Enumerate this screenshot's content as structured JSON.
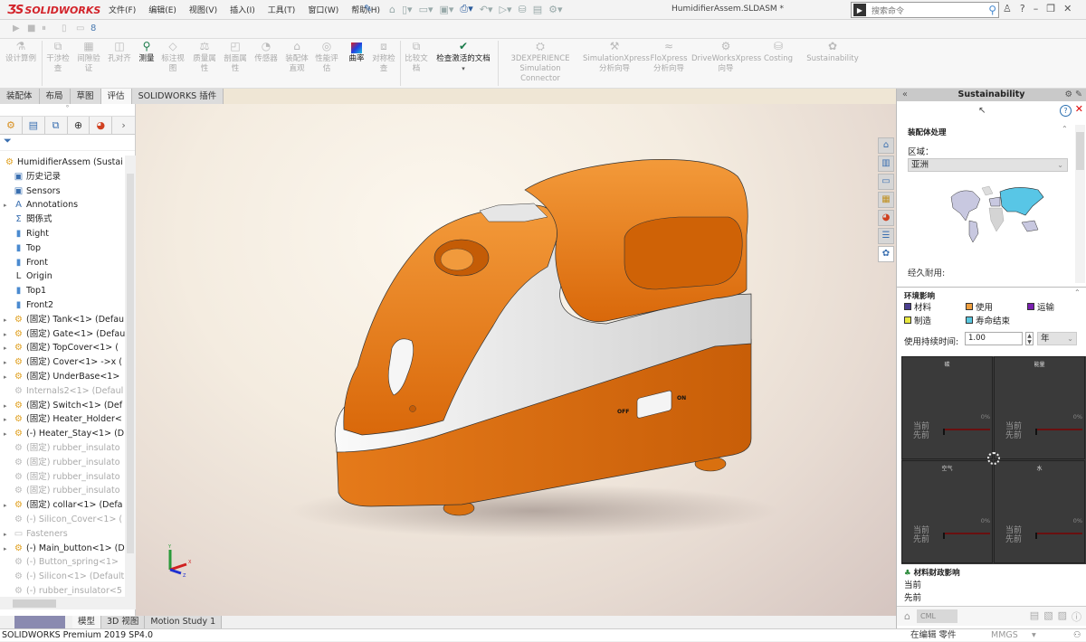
{
  "app": {
    "brand": "SOLIDWORKS",
    "document_title": "HumidifierAssem.SLDASM *",
    "menu": [
      "文件(F)",
      "编辑(E)",
      "视图(V)",
      "插入(I)",
      "工具(T)",
      "窗口(W)",
      "帮助(H)"
    ],
    "search_placeholder": "搜索命令",
    "window_controls": [
      "?",
      "–",
      "❐",
      "✕"
    ]
  },
  "command_manager": {
    "buttons": [
      {
        "label": "设计算例",
        "enabled": false
      },
      {
        "label": "干涉检查",
        "enabled": false
      },
      {
        "label": "间隙验证",
        "enabled": false
      },
      {
        "label": "孔对齐",
        "enabled": false
      },
      {
        "label": "测量",
        "enabled": true
      },
      {
        "label": "标注视图",
        "enabled": false
      },
      {
        "label": "质量属性",
        "enabled": false
      },
      {
        "label": "剖面属性",
        "enabled": false
      },
      {
        "label": "传感器",
        "enabled": false
      },
      {
        "label": "装配体直观",
        "enabled": false
      },
      {
        "label": "性能评估",
        "enabled": false
      },
      {
        "label": "曲率",
        "enabled": true
      },
      {
        "label": "对称检查",
        "enabled": false
      },
      {
        "label": "比较文档",
        "enabled": false
      },
      {
        "label": "检查激活的文档",
        "enabled": true
      },
      {
        "label": "3DEXPERIENCE Simulation Connector",
        "enabled": false
      },
      {
        "label": "SimulationXpress 分析向导",
        "enabled": false
      },
      {
        "label": "FloXpress 分析向导",
        "enabled": false
      },
      {
        "label": "DriveWorksXpress 向导",
        "enabled": false
      },
      {
        "label": "Costing",
        "enabled": false
      },
      {
        "label": "Sustainability",
        "enabled": false
      }
    ]
  },
  "tabs": [
    {
      "label": "装配体",
      "active": false
    },
    {
      "label": "布局",
      "active": false
    },
    {
      "label": "草图",
      "active": false
    },
    {
      "label": "评估",
      "active": true
    },
    {
      "label": "SOLIDWORKS 插件",
      "active": false
    }
  ],
  "feature_tree": {
    "root": "HumidifierAssem  (Sustai",
    "items": [
      {
        "label": "历史记录",
        "icon": "history-folder",
        "expandable": false,
        "dim": false
      },
      {
        "label": "Sensors",
        "icon": "sensor-folder",
        "expandable": false,
        "dim": false
      },
      {
        "label": "Annotations",
        "icon": "annotation-folder",
        "expandable": true,
        "dim": false
      },
      {
        "label": "関係式",
        "icon": "equation-folder",
        "expandable": false,
        "dim": false
      },
      {
        "label": "Right",
        "icon": "plane",
        "expandable": false,
        "dim": false
      },
      {
        "label": "Top",
        "icon": "plane",
        "expandable": false,
        "dim": false
      },
      {
        "label": "Front",
        "icon": "plane",
        "expandable": false,
        "dim": false
      },
      {
        "label": "Origin",
        "icon": "origin",
        "expandable": false,
        "dim": false
      },
      {
        "label": "Top1",
        "icon": "plane",
        "expandable": false,
        "dim": false
      },
      {
        "label": "Front2",
        "icon": "plane",
        "expandable": false,
        "dim": false
      },
      {
        "label": "(固定) Tank<1> (Defau",
        "icon": "part",
        "expandable": true,
        "dim": false
      },
      {
        "label": "(固定) Gate<1> (Defau",
        "icon": "part",
        "expandable": true,
        "dim": false
      },
      {
        "label": "(固定) TopCover<1> (",
        "icon": "part",
        "expandable": true,
        "dim": false
      },
      {
        "label": "(固定) Cover<1> ->x (",
        "icon": "part",
        "expandable": true,
        "dim": false
      },
      {
        "label": "(固定) UnderBase<1>",
        "icon": "part",
        "expandable": true,
        "dim": false
      },
      {
        "label": "Internals2<1> (Defaul",
        "icon": "part",
        "expandable": false,
        "dim": true
      },
      {
        "label": "(固定) Switch<1> (Def",
        "icon": "part",
        "expandable": true,
        "dim": false
      },
      {
        "label": "(固定) Heater_Holder<",
        "icon": "part",
        "expandable": true,
        "dim": false
      },
      {
        "label": "(-) Heater_Stay<1> (D",
        "icon": "part",
        "expandable": true,
        "dim": false
      },
      {
        "label": "(固定) rubber_insulato",
        "icon": "part",
        "expandable": false,
        "dim": true
      },
      {
        "label": "(固定) rubber_insulato",
        "icon": "part",
        "expandable": false,
        "dim": true
      },
      {
        "label": "(固定) rubber_insulato",
        "icon": "part",
        "expandable": false,
        "dim": true
      },
      {
        "label": "(固定) rubber_insulato",
        "icon": "part",
        "expandable": false,
        "dim": true
      },
      {
        "label": "(固定) collar<1> (Defa",
        "icon": "part",
        "expandable": true,
        "dim": false
      },
      {
        "label": "(-) Silicon_Cover<1> (",
        "icon": "part",
        "expandable": false,
        "dim": true
      },
      {
        "label": "Fasteners",
        "icon": "folder",
        "expandable": true,
        "dim": true
      },
      {
        "label": "(-) Main_button<1> (D",
        "icon": "part",
        "expandable": true,
        "dim": false
      },
      {
        "label": "(-) Button_spring<1>",
        "icon": "part",
        "expandable": false,
        "dim": true
      },
      {
        "label": "(-) Silicon<1> (Default",
        "icon": "part",
        "expandable": false,
        "dim": true
      },
      {
        "label": "(-) rubber_insulator<5",
        "icon": "part",
        "expandable": false,
        "dim": true
      }
    ]
  },
  "viewport": {
    "switch_off_label": "OFF",
    "switch_on_label": "ON",
    "triad_labels": [
      "Y",
      "X",
      "Z"
    ],
    "model_colors": {
      "body": "#e8780f",
      "trim": "#e6e6e6"
    }
  },
  "bottom_tabs": [
    {
      "label": "模型",
      "active": true
    },
    {
      "label": "3D 视图",
      "active": false
    },
    {
      "label": "Motion Study 1",
      "active": false
    }
  ],
  "status_bar": {
    "version": "SOLIDWORKS Premium 2019 SP4.0",
    "editing": "在编辑 零件",
    "units": "MMGS",
    "units_dropdown": "▾"
  },
  "sustainability": {
    "title": "Sustainability",
    "section_assembly": "装配体处理",
    "region_label": "区域：",
    "region_value": "亚洲",
    "durability_label": "经久耐用:",
    "section_env": "环境影响",
    "legend": [
      {
        "label": "材料",
        "color": "#4b3f8f"
      },
      {
        "label": "使用",
        "color": "#f0a040"
      },
      {
        "label": "运输",
        "color": "#7a1fb0"
      },
      {
        "label": "制造",
        "color": "#e8e840"
      },
      {
        "label": "寿命结束",
        "color": "#5ac8e0"
      }
    ],
    "use_duration_label": "使用持续时间:",
    "use_duration_value": "1.00",
    "use_duration_unit": "年",
    "impact_cells": [
      {
        "title": "碳",
        "percent": "0%",
        "current": "当前",
        "previous": "先前"
      },
      {
        "title": "能量",
        "percent": "0%",
        "current": "当前",
        "previous": "先前"
      },
      {
        "title": "空气",
        "percent": "0%",
        "current": "当前",
        "previous": "先前"
      },
      {
        "title": "水",
        "percent": "0%",
        "current": "当前",
        "previous": "先前"
      }
    ],
    "financial_title": "材料财政影响",
    "financial_current": "当前",
    "financial_previous": "先前",
    "footer_select": "CML"
  }
}
